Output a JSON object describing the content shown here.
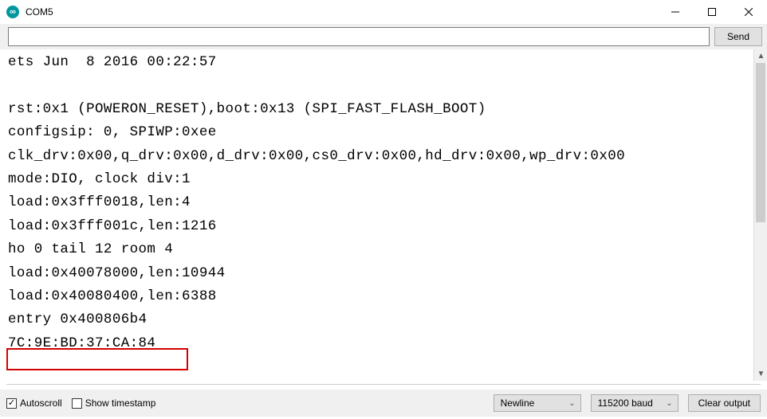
{
  "window": {
    "title": "COM5"
  },
  "sendbar": {
    "input_value": "",
    "send_label": "Send"
  },
  "output_lines": [
    "ets Jun  8 2016 00:22:57",
    "",
    "rst:0x1 (POWERON_RESET),boot:0x13 (SPI_FAST_FLASH_BOOT)",
    "configsip: 0, SPIWP:0xee",
    "clk_drv:0x00,q_drv:0x00,d_drv:0x00,cs0_drv:0x00,hd_drv:0x00,wp_drv:0x00",
    "mode:DIO, clock div:1",
    "load:0x3fff0018,len:4",
    "load:0x3fff001c,len:1216",
    "ho 0 tail 12 room 4",
    "load:0x40078000,len:10944",
    "load:0x40080400,len:6388",
    "entry 0x400806b4",
    "7C:9E:BD:37:CA:84"
  ],
  "bottom": {
    "autoscroll": {
      "label": "Autoscroll",
      "checked": true
    },
    "timestamp": {
      "label": "Show timestamp",
      "checked": false
    },
    "line_ending": {
      "selected": "Newline"
    },
    "baud": {
      "selected": "115200 baud"
    },
    "clear_label": "Clear output"
  }
}
